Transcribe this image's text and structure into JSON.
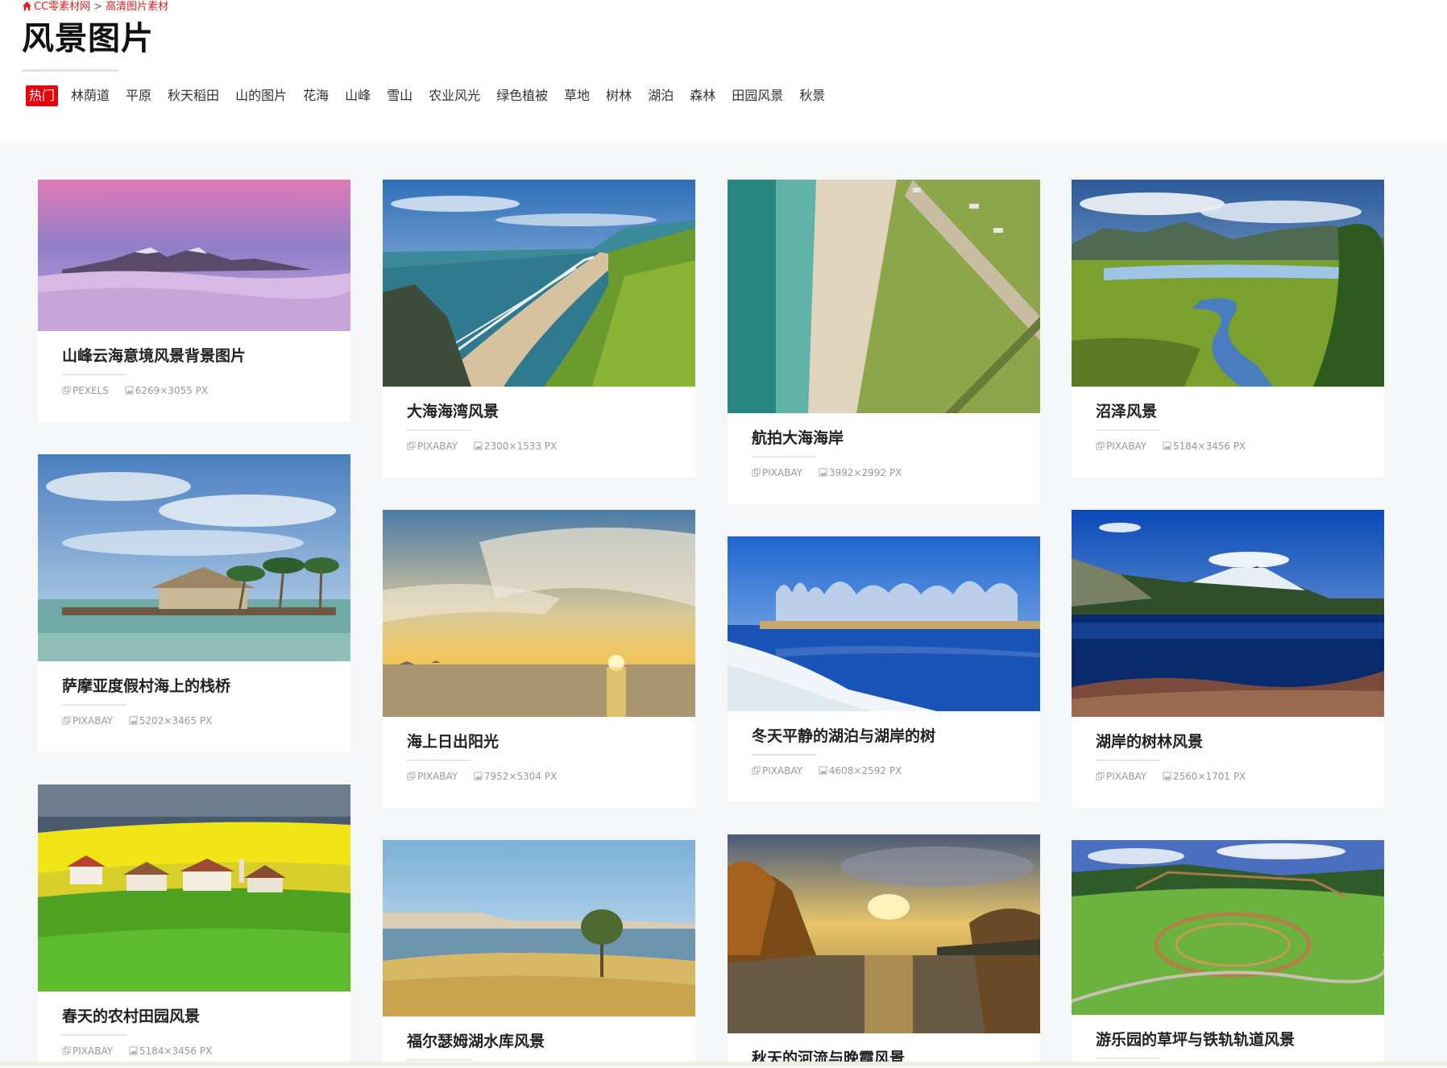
{
  "breadcrumb": {
    "home": "CC零素材网",
    "separator": ">",
    "current": "高清图片素材"
  },
  "page_title": "风景图片",
  "tags": [
    "热门",
    "林荫道",
    "平原",
    "秋天稻田",
    "山的图片",
    "花海",
    "山峰",
    "雪山",
    "农业风光",
    "绿色植被",
    "草地",
    "树林",
    "湖泊",
    "森林",
    "田园风景",
    "秋景"
  ],
  "colors": {
    "accent": "#e8000a",
    "breadcrumb": "#e02020"
  },
  "icons": {
    "home": "home-icon",
    "source": "copy-icon",
    "size": "image-icon"
  },
  "cards": [
    {
      "title": "山峰云海意境风景背景图片",
      "source": "PEXELS",
      "size": "6269×3055 PX",
      "scene": "mountain-clouds"
    },
    {
      "title": "萨摩亚度假村海上的栈桥",
      "source": "PIXABAY",
      "size": "5202×3465 PX",
      "scene": "pier"
    },
    {
      "title": "春天的农村田园风景",
      "source": "PIXABAY",
      "size": "5184×3456 PX",
      "scene": "village"
    },
    {
      "title": "大海海湾风景",
      "source": "PIXABAY",
      "size": "2300×1533 PX",
      "scene": "bay"
    },
    {
      "title": "海上日出阳光",
      "source": "PIXABAY",
      "size": "7952×5304 PX",
      "scene": "sunrise"
    },
    {
      "title": "福尔瑟姆湖水库风景",
      "source": "",
      "size": "",
      "scene": "lake-tree"
    },
    {
      "title": "航拍大海海岸",
      "source": "PIXABAY",
      "size": "3992×2992 PX",
      "scene": "aerial"
    },
    {
      "title": "冬天平静的湖泊与湖岸的树",
      "source": "PIXABAY",
      "size": "4608×2592 PX",
      "scene": "winter"
    },
    {
      "title": "秋天的河流与晚霞风景",
      "source": "",
      "size": "",
      "scene": "autumn"
    },
    {
      "title": "沼泽风景",
      "source": "PIXABAY",
      "size": "5184×3456 PX",
      "scene": "swamp"
    },
    {
      "title": "湖岸的树林风景",
      "source": "PIXABAY",
      "size": "2560×1701 PX",
      "scene": "lake-mountain"
    },
    {
      "title": "游乐园的草坪与铁轨轨道风景",
      "source": "",
      "size": "",
      "scene": "park"
    }
  ]
}
